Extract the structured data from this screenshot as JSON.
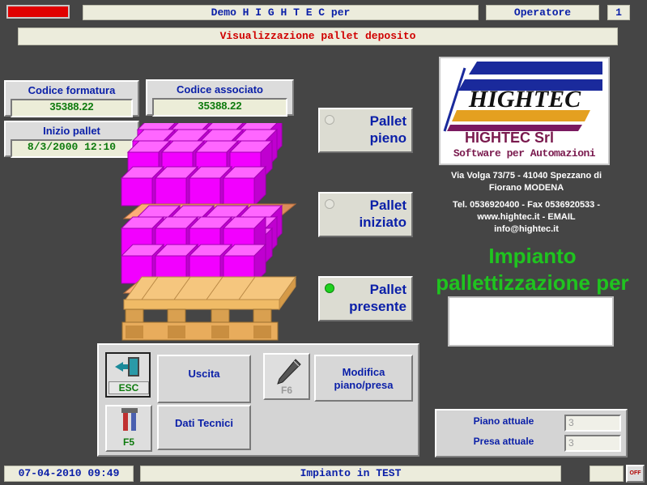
{
  "top_bar": {
    "title": "Demo H I G H T E C per",
    "user_label": "Operatore",
    "user_level": "1"
  },
  "subtitle": "Visualizzazione pallet deposito",
  "fields": {
    "codice_formatura_label": "Codice formatura",
    "codice_formatura_value": "35388.22",
    "codice_associato_label": "Codice associato",
    "codice_associato_value": "35388.22",
    "inizio_pallet_label": "Inizio pallet",
    "inizio_pallet_value": "8/3/2000 12:10"
  },
  "pallet_buttons": {
    "pieno_line1": "Pallet",
    "pieno_line2": "pieno",
    "iniziato_line1": "Pallet",
    "iniziato_line2": "iniziato",
    "presente_line1": "Pallet",
    "presente_line2": "presente"
  },
  "company": {
    "logo_text": "HIGHTEC",
    "name": "HIGHTEC Srl",
    "tagline": "Software per Automazioni",
    "address_line1": "Via Volga 73/75 - 41040 Spezzano di",
    "address_line2": "Fiorano MODENA",
    "contact_line1": "Tel. 0536920400 - Fax 0536920533 -",
    "contact_line2": "www.hightec.it - EMAIL",
    "contact_line3": "info@hightec.it"
  },
  "plant": {
    "line1": "Impianto",
    "line2": "pallettizzazione per"
  },
  "function_keys": {
    "esc_key": "ESC",
    "esc_label": "Uscita",
    "f6_key": "F6",
    "f6_label_line1": "Modifica",
    "f6_label_line2": "piano/presa",
    "f5_key": "F5",
    "f5_label": "Dati Tecnici"
  },
  "counters": {
    "piano_label": "Piano attuale",
    "piano_value": "3",
    "presa_label": "Presa attuale",
    "presa_value": "3"
  },
  "status_bar": {
    "datetime": "07-04-2010 09:49",
    "message": "Impianto in TEST",
    "corner_icon_text": "OFF"
  },
  "colors": {
    "background": "#454545",
    "accent_blue": "#0a1fa8",
    "alarm_red": "#e00000",
    "plant_green": "#1fc41f",
    "box_magenta": "#f200ff"
  }
}
